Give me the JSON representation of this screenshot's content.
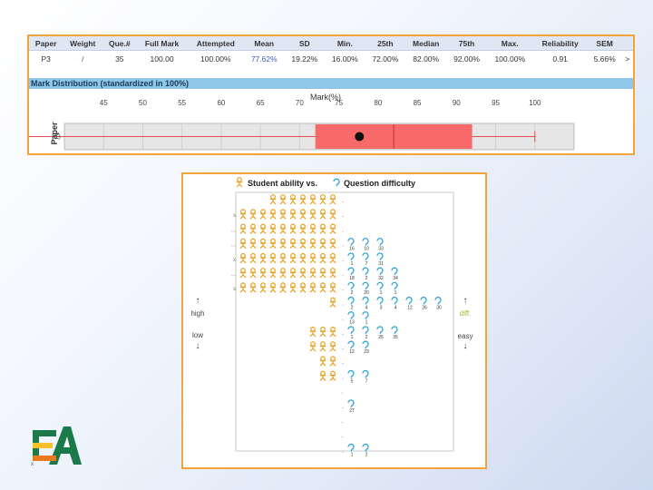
{
  "stats": {
    "headers": [
      "Paper",
      "Weight",
      "Que.#",
      "Full Mark",
      "Attempted",
      "Mean",
      "SD",
      "Min.",
      "25th",
      "Median",
      "75th",
      "Max.",
      "Reliability",
      "SEM"
    ],
    "row": [
      "P3",
      "/",
      "35",
      "100.00",
      "100.00%",
      "77.62%",
      "19.22%",
      "16.00%",
      "72.00%",
      "82.00%",
      "92.00%",
      "100.00%",
      "0.91",
      "5.66%"
    ],
    "more": ">"
  },
  "distribution": {
    "title": "Mark Distribution (standardized in 100%)",
    "axis_label": "Mark(%)",
    "ticks": [
      "45",
      "50",
      "55",
      "60",
      "65",
      "70",
      "75",
      "80",
      "85",
      "90",
      "95",
      "100"
    ],
    "ylabel": "Paper",
    "row_label": "P3",
    "colors": {
      "box": "#f86a6a",
      "grid": "#d0d0d0",
      "whisker": "#e05050"
    }
  },
  "chart_data": {
    "type": "box",
    "axis_label": "Mark(%)",
    "xlim": [
      40,
      105
    ],
    "series": [
      {
        "name": "P3",
        "min": 16,
        "q1": 72,
        "median": 82,
        "q3": 92,
        "max": 100,
        "mean": 77.62
      }
    ]
  },
  "wright": {
    "title_a": "Student ability vs.",
    "title_b": "Question difficulty",
    "high": "high",
    "low": "low",
    "diff": "diff.",
    "easy": "easy",
    "arrow_up": "↑",
    "arrow_down": "↓",
    "rows": [
      {
        "mark": "",
        "persons": 7,
        "q": []
      },
      {
        "mark": "s",
        "persons": 10,
        "q": []
      },
      {
        "mark": "...",
        "persons": 10,
        "q": []
      },
      {
        "mark": "...",
        "persons": 10,
        "q": [
          "16",
          "10",
          "33"
        ]
      },
      {
        "mark": "x",
        "persons": 10,
        "q": [
          "1",
          "7",
          "31"
        ]
      },
      {
        "mark": "...",
        "persons": 10,
        "q": [
          "18",
          "2",
          "32",
          "34"
        ]
      },
      {
        "mark": "s",
        "persons": 10,
        "q": [
          "2",
          "20",
          "1",
          "1"
        ]
      },
      {
        "mark": "",
        "persons": 1,
        "q": [
          "2",
          "4",
          "3",
          "4",
          "12",
          "26",
          "30"
        ]
      },
      {
        "mark": "",
        "persons": 0,
        "q": [
          "13",
          "1"
        ]
      },
      {
        "mark": "",
        "persons": 3,
        "q": [
          "1",
          "2",
          "25",
          "35"
        ]
      },
      {
        "mark": "",
        "persons": 3,
        "q": [
          "12",
          "23"
        ]
      },
      {
        "mark": "",
        "persons": 2,
        "q": []
      },
      {
        "mark": "",
        "persons": 2,
        "q": [
          "5",
          "7"
        ]
      },
      {
        "mark": "",
        "persons": 0,
        "q": []
      },
      {
        "mark": "",
        "persons": 0,
        "q": [
          "27"
        ]
      },
      {
        "mark": "",
        "persons": 0,
        "q": []
      },
      {
        "mark": "",
        "persons": 0,
        "q": []
      },
      {
        "mark": "",
        "persons": 0,
        "q": [
          "1",
          "2"
        ]
      }
    ],
    "colors": {
      "person": "#e8a020",
      "question": "#2aa5d8",
      "diff": "#9bbb35"
    }
  },
  "logo": {
    "letters": "EA",
    "small": "x",
    "colors": {
      "green": "#1a7a4a",
      "orange": "#e87c1c",
      "yellow": "#f6c12a"
    }
  }
}
